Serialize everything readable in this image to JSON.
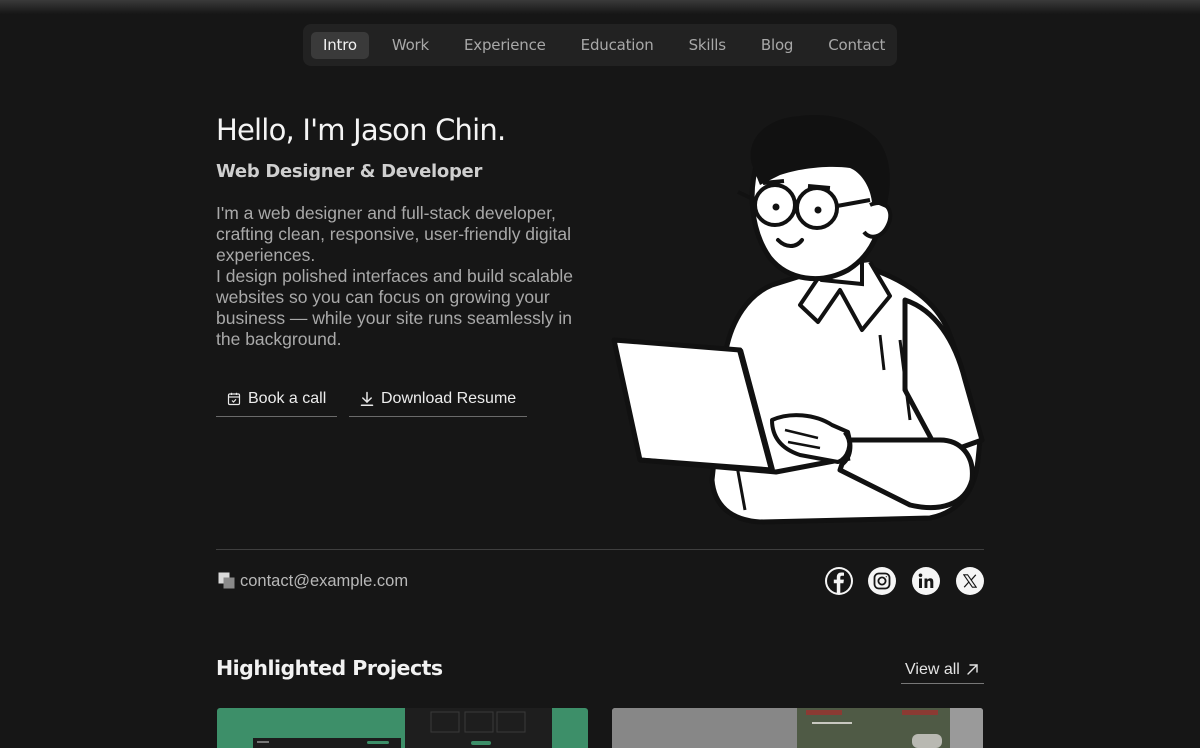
{
  "nav": {
    "items": [
      {
        "label": "Intro",
        "active": true
      },
      {
        "label": "Work",
        "active": false
      },
      {
        "label": "Experience",
        "active": false
      },
      {
        "label": "Education",
        "active": false
      },
      {
        "label": "Skills",
        "active": false
      },
      {
        "label": "Blog",
        "active": false
      },
      {
        "label": "Contact",
        "active": false
      }
    ]
  },
  "hero": {
    "title": "Hello, I'm Jason Chin.",
    "subtitle": "Web Designer & Developer",
    "paragraph_1": "I'm a web designer and full-stack developer, crafting clean, responsive, user-friendly digital experiences.",
    "paragraph_2": "I design polished interfaces and build scalable websites so you can focus on growing your business — while your site runs seamlessly in the background.",
    "book_call_label": "Book a call",
    "download_resume_label": "Download Resume"
  },
  "contact": {
    "email": "contact@example.com",
    "socials": [
      {
        "icon": "facebook-icon"
      },
      {
        "icon": "instagram-icon"
      },
      {
        "icon": "linkedin-icon"
      },
      {
        "icon": "x-icon"
      }
    ]
  },
  "projects": {
    "title": "Highlighted Projects",
    "view_all_label": "View all"
  },
  "colors": {
    "background": "#161616",
    "nav_bg": "#222222",
    "nav_active": "#3a3a3a",
    "card_green": "#3d8f69"
  }
}
